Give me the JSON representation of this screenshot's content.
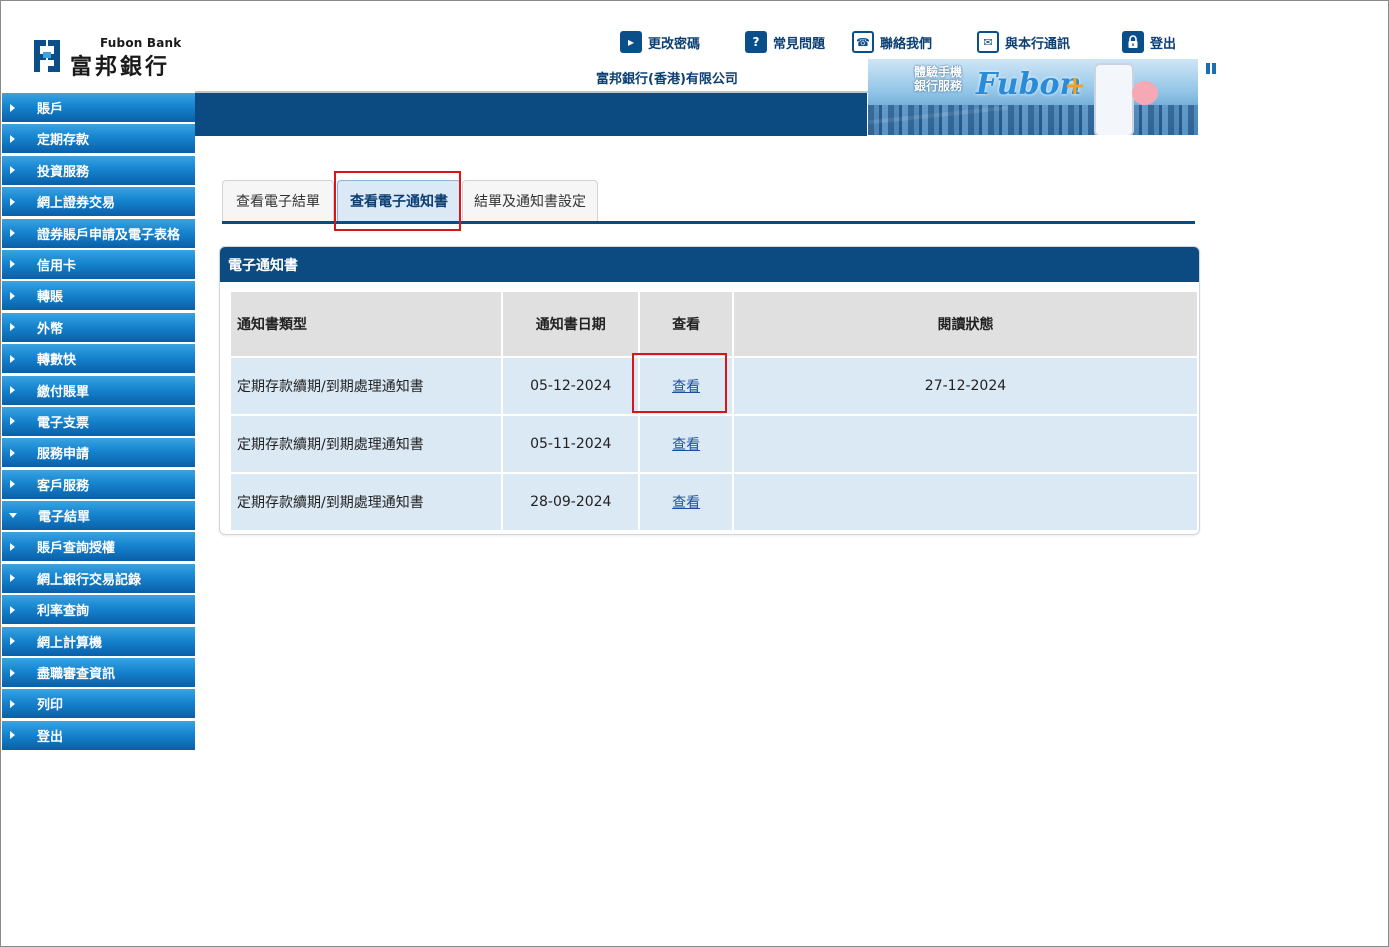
{
  "logo": {
    "en": "Fubon Bank",
    "zh": "富邦銀行"
  },
  "toplinks": [
    {
      "label": "更改密碼",
      "icon": "play-icon"
    },
    {
      "label": "常見問題",
      "icon": "question-icon"
    },
    {
      "label": "聯絡我們",
      "icon": "phone-icon"
    },
    {
      "label": "與本行通訊",
      "icon": "mail-icon"
    },
    {
      "label": "登出",
      "icon": "lock-icon"
    }
  ],
  "company": "富邦銀行(香港)有限公司",
  "banner": {
    "tagline_line1": "體驗手機",
    "tagline_line2": "銀行服務",
    "brand": "Fubon",
    "plus": "+"
  },
  "sidebar": {
    "items": [
      {
        "label": "賬戶",
        "expanded": false
      },
      {
        "label": "定期存款",
        "expanded": false
      },
      {
        "label": "投資服務",
        "expanded": false
      },
      {
        "label": "網上證券交易",
        "expanded": false
      },
      {
        "label": "證券賬戶申請及電子表格",
        "expanded": false
      },
      {
        "label": "信用卡",
        "expanded": false
      },
      {
        "label": "轉賬",
        "expanded": false
      },
      {
        "label": "外幣",
        "expanded": false
      },
      {
        "label": "轉數快",
        "expanded": false
      },
      {
        "label": "繳付賬單",
        "expanded": false
      },
      {
        "label": "電子支票",
        "expanded": false
      },
      {
        "label": "服務申請",
        "expanded": false
      },
      {
        "label": "客戶服務",
        "expanded": false
      },
      {
        "label": "電子結單",
        "expanded": true
      },
      {
        "label": "賬戶查詢授權",
        "expanded": false
      },
      {
        "label": "網上銀行交易記錄",
        "expanded": false
      },
      {
        "label": "利率查詢",
        "expanded": false
      },
      {
        "label": "網上計算機",
        "expanded": false
      },
      {
        "label": "盡職審查資訊",
        "expanded": false
      },
      {
        "label": "列印",
        "expanded": false
      },
      {
        "label": "登出",
        "expanded": false
      }
    ]
  },
  "tabs": [
    {
      "label": "查看電子結單",
      "active": false
    },
    {
      "label": "查看電子通知書",
      "active": true
    },
    {
      "label": "結單及通知書設定",
      "active": false
    }
  ],
  "panel": {
    "title": "電子通知書",
    "headers": [
      "通知書類型",
      "通知書日期",
      "查看",
      "閱讀狀態"
    ],
    "rows": [
      {
        "type": "定期存款續期/到期處理通知書",
        "date": "05-12-2024",
        "view": "查看",
        "status": "27-12-2024"
      },
      {
        "type": "定期存款續期/到期處理通知書",
        "date": "05-11-2024",
        "view": "查看",
        "status": ""
      },
      {
        "type": "定期存款續期/到期處理通知書",
        "date": "28-09-2024",
        "view": "查看",
        "status": ""
      }
    ]
  },
  "colors": {
    "navy": "#0c4a82",
    "sidebar_blue": "#1684cf",
    "highlight_red": "#d9141b",
    "row_blue": "#dbe9f5"
  }
}
